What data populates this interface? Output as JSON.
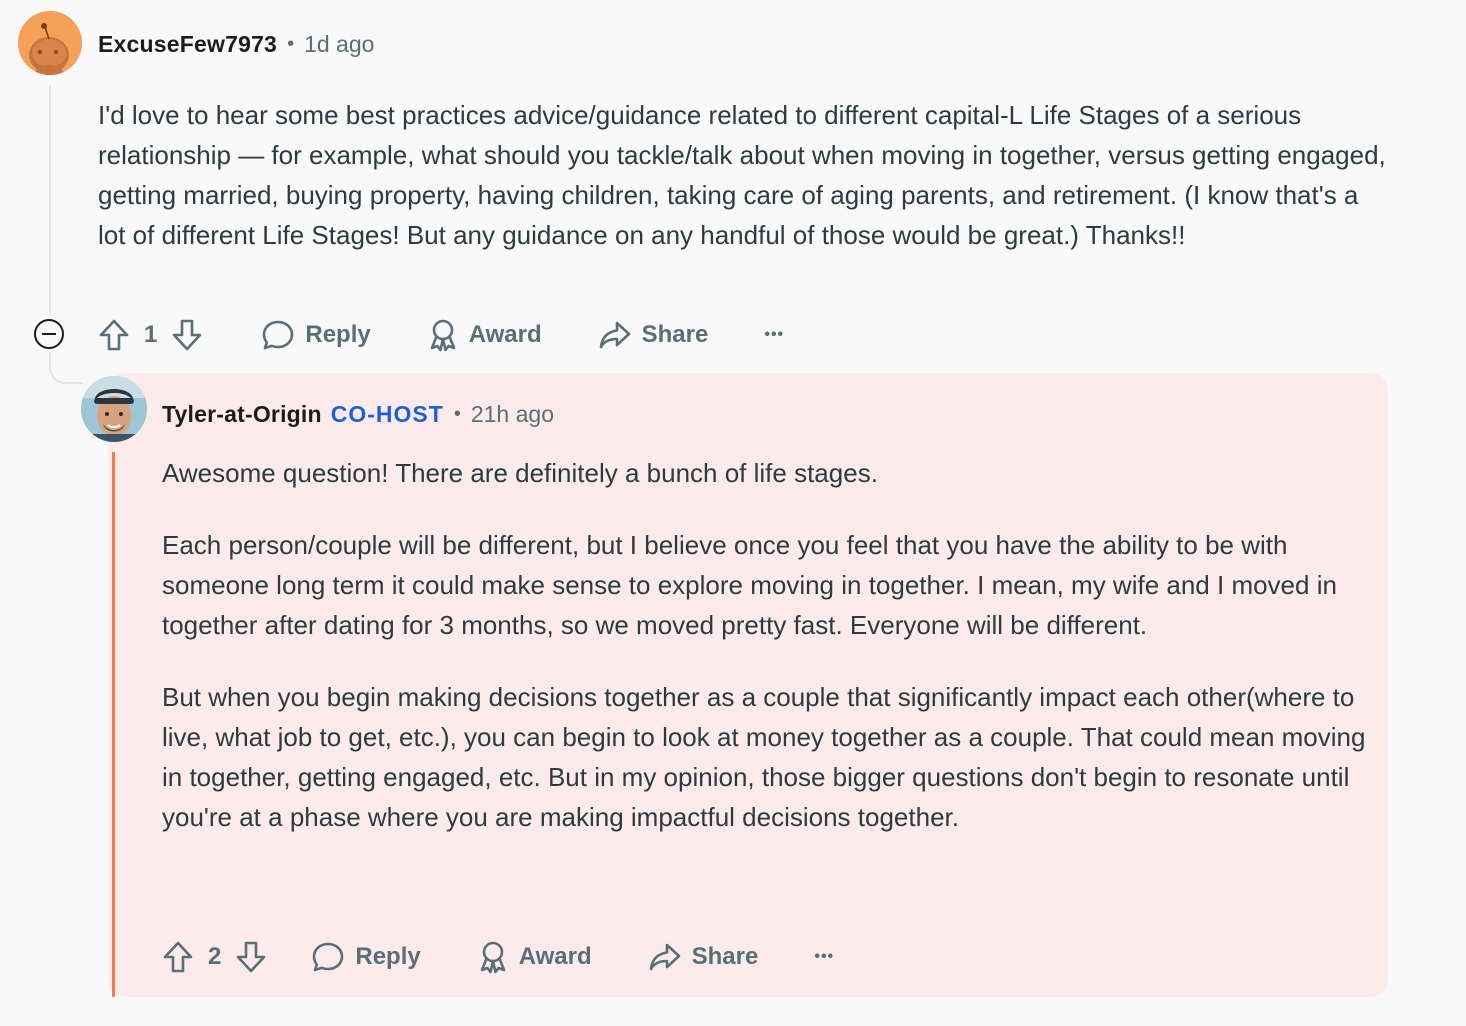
{
  "comment": {
    "author": "ExcuseFew7973",
    "separator": "•",
    "time": "1d ago",
    "body": "I'd love to hear some best practices advice/guidance related to different capital-L Life Stages of a serious relationship — for example, what should you tackle/talk about when moving in together, versus getting engaged, getting married, buying property, having children, taking care of aging parents, and retirement. (I know that's a lot of different Life Stages! But any guidance on any handful of those would be great.) Thanks!!",
    "votes": "1",
    "actions": {
      "reply": "Reply",
      "award": "Award",
      "share": "Share",
      "more": "•••"
    }
  },
  "reply": {
    "author": "Tyler-at-Origin",
    "flair": "CO-HOST",
    "separator": "•",
    "time": "21h ago",
    "paragraphs": [
      "Awesome question! There are definitely a bunch of life stages.",
      "Each person/couple will be different, but I believe once you feel that you have the ability to be with someone long term it could make sense to explore moving in together. I mean, my wife and I moved in together after dating for 3 months, so we moved pretty fast. Everyone will be different.",
      "But when you begin making decisions together as a couple that significantly impact each other(where to live, what job to get, etc.), you can begin to look at money together as a couple. That could mean moving in together, getting engaged, etc. But in my opinion, those bigger questions don't begin to resonate until you're at a phase where you are making impactful decisions together."
    ],
    "votes": "2",
    "actions": {
      "reply": "Reply",
      "award": "Award",
      "share": "Share",
      "more": "•••"
    }
  },
  "colors": {
    "flair": "#1e5fd6",
    "reply_background": "#fcebea",
    "reply_accent_bar": "#f0804a",
    "muted_text": "#576f76"
  },
  "icons": {
    "parent_avatar": "reddit-snoo-avatar",
    "reply_avatar": "user-photo-avatar",
    "collapse": "collapse-minus-icon",
    "upvote": "upvote-arrow-icon",
    "downvote": "downvote-arrow-icon",
    "reply": "speech-bubble-icon",
    "award": "award-ribbon-icon",
    "share": "share-arrow-icon",
    "more": "more-dots-icon"
  }
}
